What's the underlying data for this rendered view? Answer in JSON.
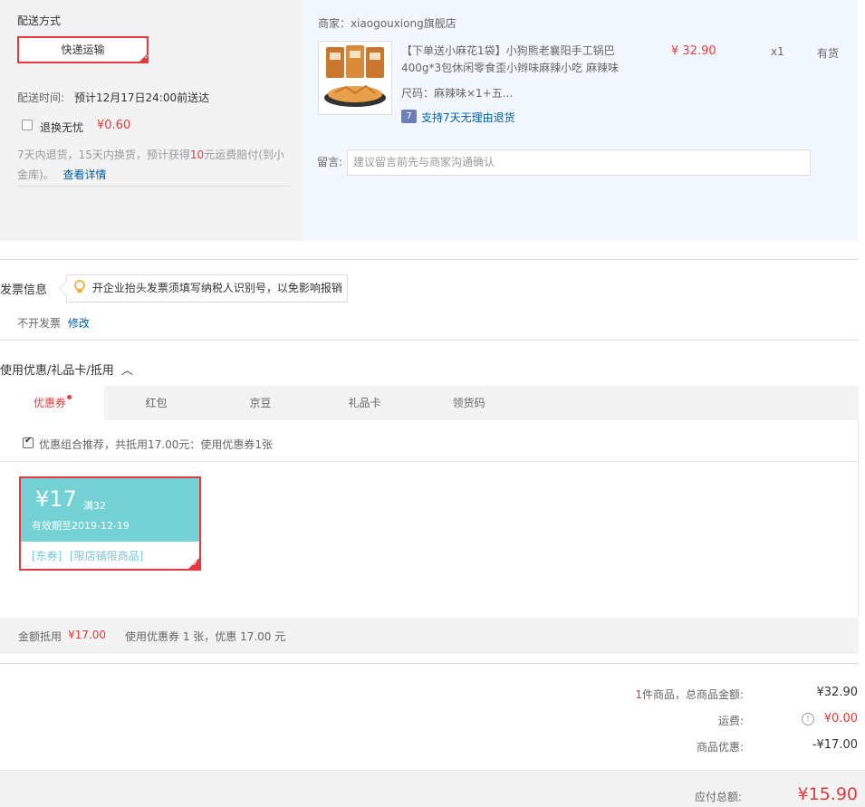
{
  "shipping": {
    "title": "配送方式",
    "method": "快递运输",
    "time_label": "配送时间:",
    "time_value": "预计12月17日24:00前送达",
    "insurance_label": "退换无忧",
    "insurance_price": "¥0.60",
    "desc_part1": "7天内退货，15天内换货，预计获得",
    "desc_highlight": "10",
    "desc_part2": "元运费赔付(到小",
    "desc_line2": "金库)。",
    "details_link": "查看详情"
  },
  "merchant": {
    "label": "商家：xiaogouxiong旗舰店"
  },
  "product": {
    "title_line1": "【下单送小麻花1袋】小狗熊老襄阳手工锅巴",
    "title_line2": "400g*3包休闲零食歪小辫味麻辣小吃 麻辣味",
    "price": "¥ 32.90",
    "quantity": "x1",
    "stock": "有货",
    "spec": "尺码：麻辣味×1+五...",
    "return_badge": "7",
    "return_text": "支持7天无理由退货"
  },
  "remark": {
    "label": "留言:",
    "placeholder": "建议留言前先与商家沟通确认"
  },
  "invoice": {
    "title": "发票信息",
    "tip": "开企业抬头发票须填写纳税人识别号，以免影响报销",
    "status": "不开发票",
    "edit": "修改"
  },
  "discount": {
    "title": "使用优惠/礼品卡/抵用",
    "tabs": [
      "优惠券",
      "红包",
      "京豆",
      "礼品卡",
      "领货码"
    ],
    "recommend": "优惠组合推荐，共抵用17.00元：使用优惠券1张",
    "coupon": {
      "amount": "¥17",
      "condition": "满32",
      "expiry": "有效期至2019-12-19",
      "tag1": "[东券]",
      "tag2": "[限店铺限商品]"
    },
    "summary_label": "金额抵用",
    "summary_amount": "¥17.00",
    "summary_detail": "使用优惠券 1 张，优惠 17.00 元"
  },
  "totals": {
    "count": "1",
    "goods_label": "件商品，总商品金额:",
    "goods_amount": "¥32.90",
    "freight_label": "运费:",
    "freight_amount": "¥0.00",
    "discount_label": "商品优惠:",
    "discount_amount": "-¥17.00",
    "payable_label": "应付总额:",
    "payable_amount": "¥15.90"
  },
  "colors": {
    "accent": "#e4393c",
    "link": "#005ea7",
    "coupon": "#74d2d4",
    "orange": "#e4393c"
  }
}
